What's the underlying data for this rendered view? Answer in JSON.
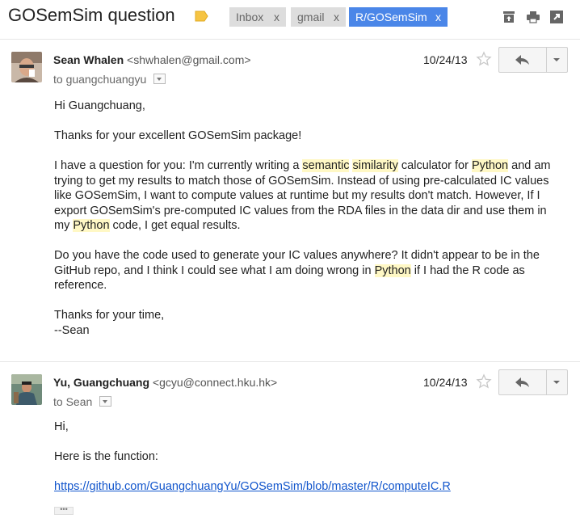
{
  "thread": {
    "subject": "GOSemSim question",
    "labels": [
      {
        "name": "Inbox",
        "remove": "x"
      },
      {
        "name": "gmail",
        "remove": "x"
      },
      {
        "name": "R/GOSemSim",
        "remove": "x"
      }
    ],
    "important_color": "#f6c443",
    "icons": [
      "archive-icon",
      "print-icon",
      "new-window-icon"
    ]
  },
  "messages": [
    {
      "sender_name": "Sean Whalen",
      "sender_email": "<shwhalen@gmail.com>",
      "to_prefix": "to",
      "to_name": "guangchuangyu",
      "date": "10/24/13",
      "body": {
        "greeting": "Hi Guangchuang,",
        "thanks": "Thanks for your excellent GOSemSim package!",
        "para1": [
          {
            "text": "I have a question for you:  I'm currently writing a "
          },
          {
            "text": "semantic",
            "hl": true
          },
          {
            "text": " "
          },
          {
            "text": "similarity",
            "hl": true
          },
          {
            "text": " calculator for "
          },
          {
            "text": "Python",
            "hl": true
          },
          {
            "text": " and am trying to get my results to match those of GOSemSim.  Instead of using pre-calculated IC values like GOSemSim, I want to compute values at runtime but my results don't match.  However, If I export GOSemSim's pre-computed IC values from the RDA files in the data dir and use them in my "
          },
          {
            "text": "Python",
            "hl": true
          },
          {
            "text": " code, I get equal results."
          }
        ],
        "para2": [
          {
            "text": "Do you have the code used to generate your IC values anywhere?  It didn't appear to be in the GitHub repo, and I think I could see what I am doing wrong in "
          },
          {
            "text": "Python",
            "hl": true
          },
          {
            "text": " if I had the R code as reference."
          }
        ],
        "closing": "Thanks for your time,",
        "signature": "--Sean"
      }
    },
    {
      "sender_name": "Yu, Guangchuang",
      "sender_email": "<gcyu@connect.hku.hk>",
      "to_prefix": "to",
      "to_name": "Sean",
      "date": "10/24/13",
      "body": {
        "greeting": "Hi,",
        "line1": "Here is the function:",
        "link": "https://github.com/GuangchuangYu/GOSemSim/blob/master/R/computeIC.R",
        "trimmed": "•••"
      }
    }
  ]
}
